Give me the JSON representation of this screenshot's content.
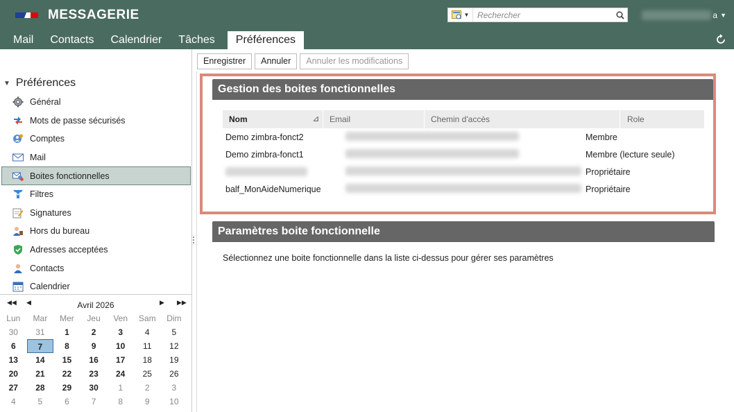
{
  "app": {
    "title": "MESSAGERIE",
    "colors": {
      "topbar": "#4a6b60",
      "highlight": "#d98a7c",
      "section_header": "#666666",
      "selected_nav": "#c8d4d0",
      "today": "#9cc3df"
    }
  },
  "search": {
    "placeholder": "Recherche",
    "placeholder_full": "Rechercher"
  },
  "user": {
    "suffix": "a"
  },
  "tabs": [
    {
      "label": "Mail"
    },
    {
      "label": "Contacts"
    },
    {
      "label": "Calendrier"
    },
    {
      "label": "Tâches"
    },
    {
      "label": "Préférences",
      "active": true
    }
  ],
  "toolbar": {
    "save": "Enregistrer",
    "cancel": "Annuler",
    "discard": "Annuler les modifications"
  },
  "sidebar": {
    "title": "Préférences",
    "items": [
      {
        "label": "Général",
        "icon": "gear-icon"
      },
      {
        "label": "Mots de passe sécurisés",
        "icon": "key-swap-icon"
      },
      {
        "label": "Comptes",
        "icon": "accounts-icon"
      },
      {
        "label": "Mail",
        "icon": "envelope-icon"
      },
      {
        "label": "Boites fonctionnelles",
        "icon": "shared-mailbox-icon",
        "selected": true
      },
      {
        "label": "Filtres",
        "icon": "filter-icon"
      },
      {
        "label": "Signatures",
        "icon": "signature-icon"
      },
      {
        "label": "Hors du bureau",
        "icon": "out-of-office-icon"
      },
      {
        "label": "Adresses acceptées",
        "icon": "shield-check-icon"
      },
      {
        "label": "Contacts",
        "icon": "contact-icon"
      },
      {
        "label": "Calendrier",
        "icon": "calendar-icon"
      }
    ]
  },
  "calendar": {
    "month_label": "Avril 2026",
    "days_of_week": [
      "Lun",
      "Mar",
      "Mer",
      "Jeu",
      "Ven",
      "Sam",
      "Dim"
    ],
    "weeks": [
      [
        "30",
        "31",
        "1",
        "2",
        "3",
        "4",
        "5"
      ],
      [
        "6",
        "7",
        "8",
        "9",
        "10",
        "11",
        "12"
      ],
      [
        "13",
        "14",
        "15",
        "16",
        "17",
        "18",
        "19"
      ],
      [
        "20",
        "21",
        "22",
        "23",
        "24",
        "25",
        "26"
      ],
      [
        "27",
        "28",
        "29",
        "30",
        "1",
        "2",
        "3"
      ],
      [
        "4",
        "5",
        "6",
        "7",
        "8",
        "9",
        "10"
      ]
    ],
    "today": "7"
  },
  "gestion": {
    "title": "Gestion des boites fonctionnelles",
    "columns": {
      "nom": "Nom",
      "email": "Email",
      "chemin": "Chemin d'accès",
      "role": "Role"
    },
    "rows": [
      {
        "nom": "Demo zimbra-fonct2",
        "role": "Membre"
      },
      {
        "nom": "Demo zimbra-fonct1",
        "role": "Membre (lecture seule)"
      },
      {
        "nom": "",
        "role": "Propriétaire"
      },
      {
        "nom": "balf_MonAideNumerique",
        "role": "Propriétaire"
      }
    ]
  },
  "params": {
    "title": "Paramètres boite fonctionnelle",
    "hint": "Sélectionnez une boite fonctionnelle dans la liste ci-dessus pour gérer ses paramètres"
  }
}
